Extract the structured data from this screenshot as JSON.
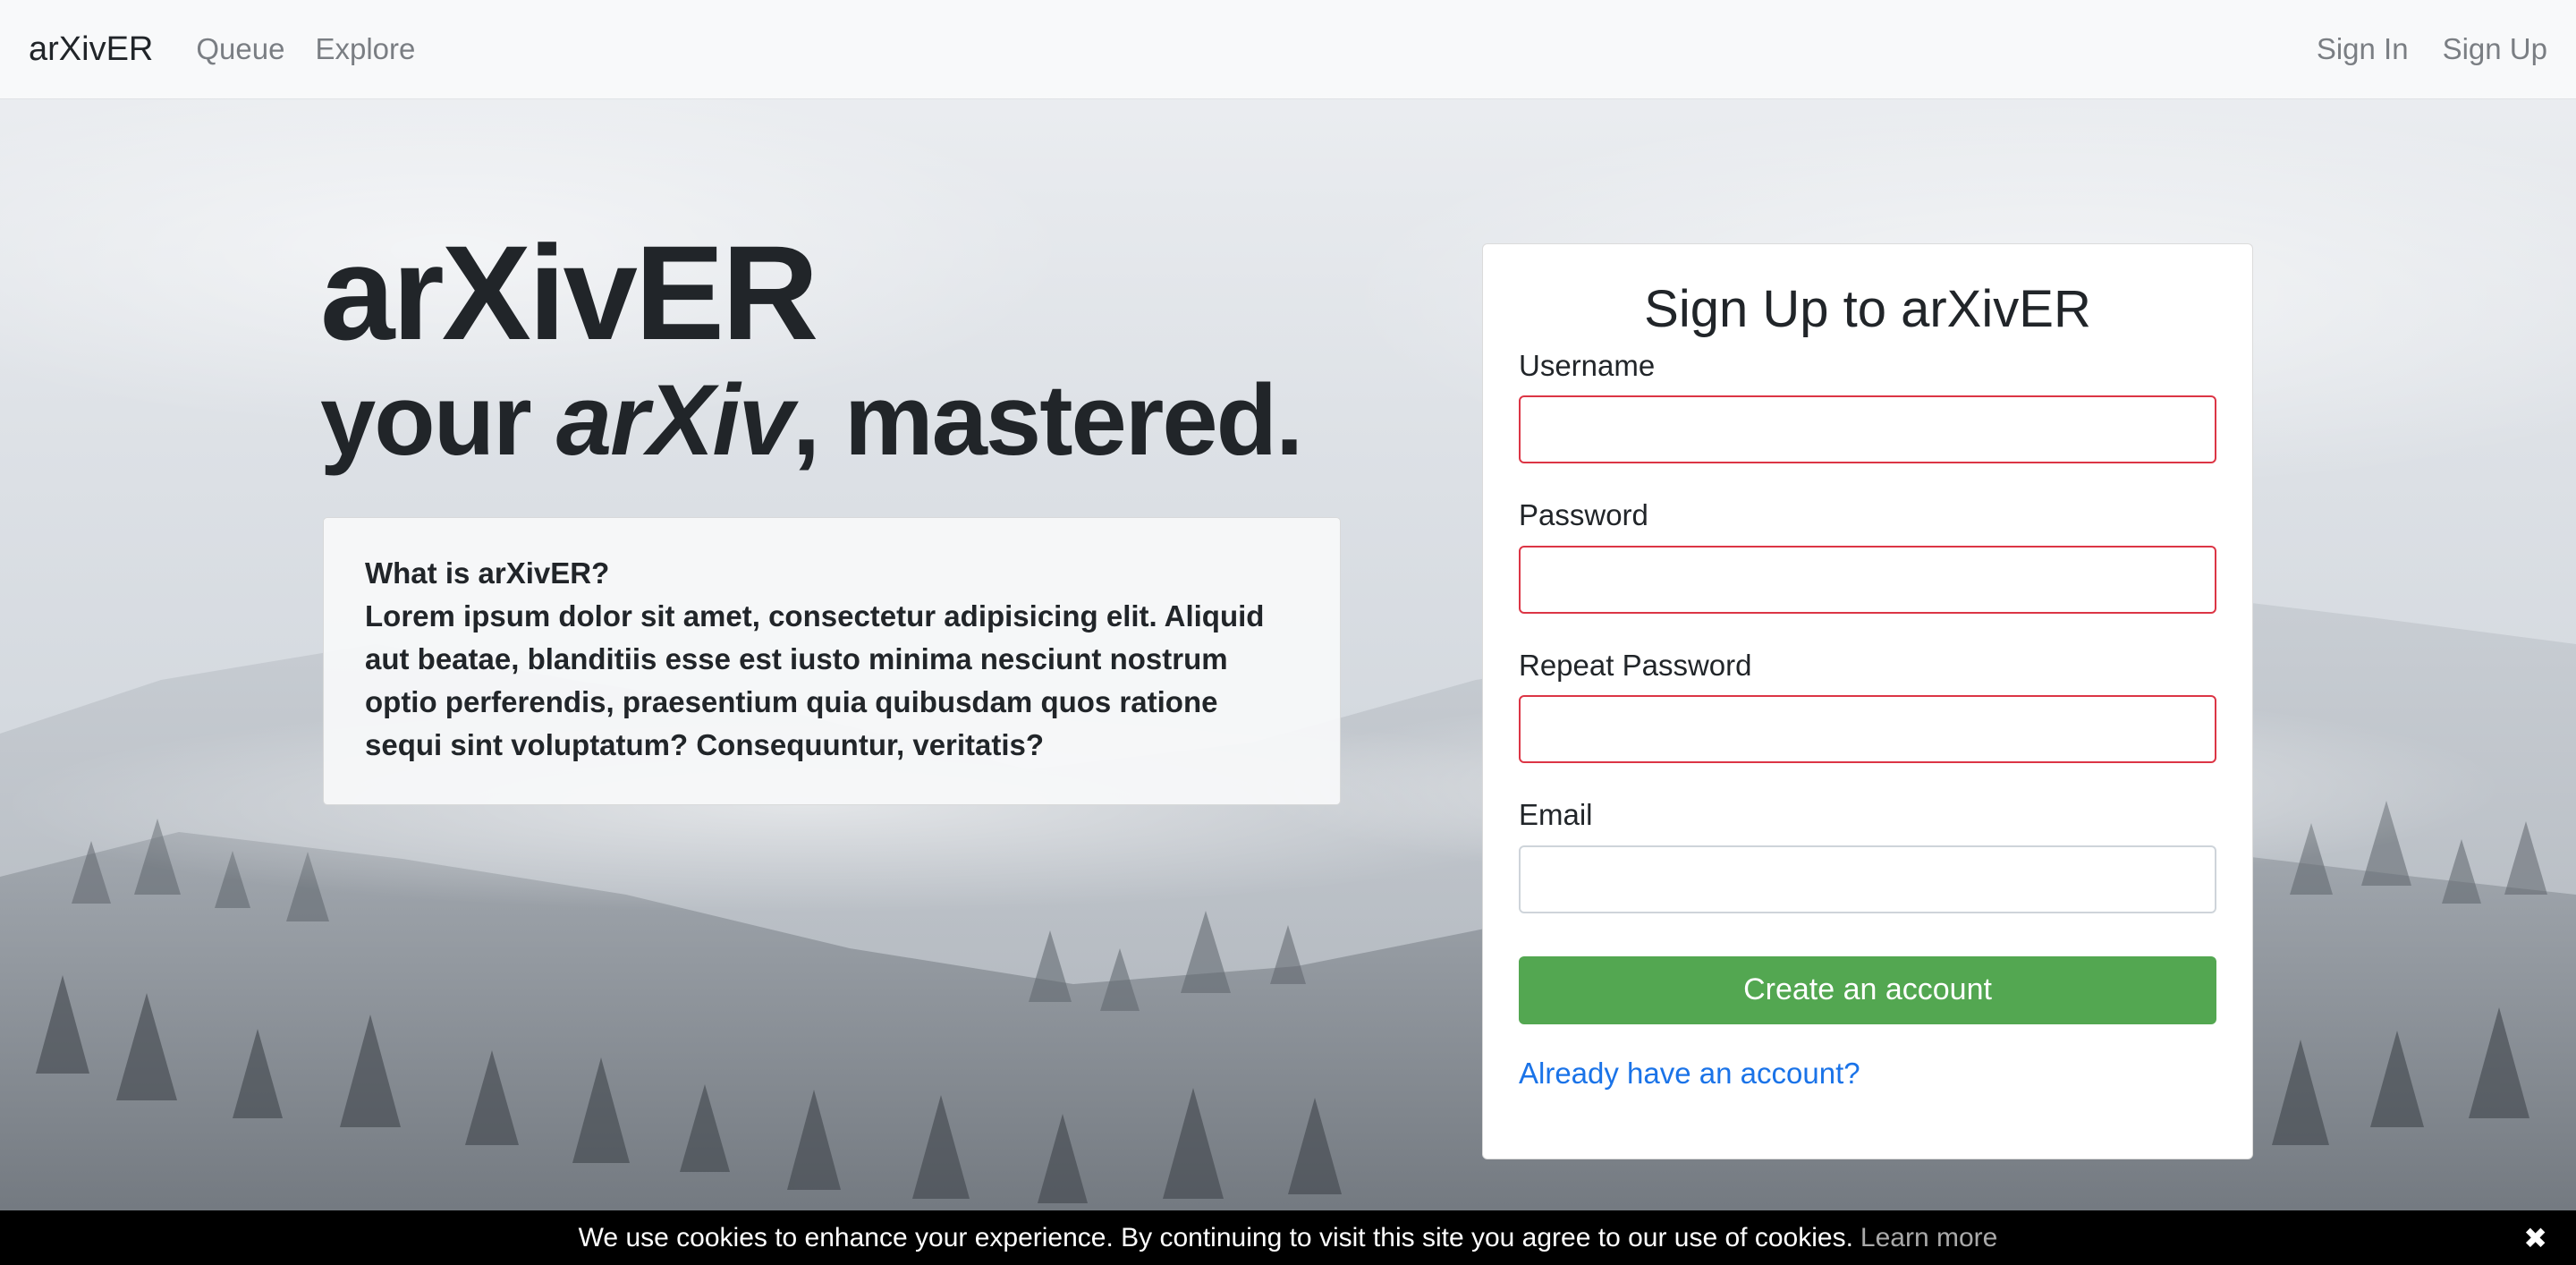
{
  "navbar": {
    "brand": "arXivER",
    "links": [
      {
        "label": "Queue"
      },
      {
        "label": "Explore"
      }
    ],
    "right_links": [
      {
        "label": "Sign In"
      },
      {
        "label": "Sign Up"
      }
    ]
  },
  "hero": {
    "title": "arXivER",
    "subtitle_prefix": "your ",
    "subtitle_emphasis": "arXiv",
    "subtitle_suffix": ", mastered.",
    "info_heading": "What is arXivER?",
    "info_body": "Lorem ipsum dolor sit amet, consectetur adipisicing elit. Aliquid aut beatae, blanditiis esse est iusto minima nesciunt nostrum optio perferendis, praesentium quia quibusdam quos ratione sequi sint voluptatum? Consequuntur, veritatis?"
  },
  "signup": {
    "title": "Sign Up to arXivER",
    "fields": [
      {
        "label": "Username",
        "value": "",
        "state": "invalid"
      },
      {
        "label": "Password",
        "value": "",
        "state": "invalid"
      },
      {
        "label": "Repeat Password",
        "value": "",
        "state": "invalid"
      },
      {
        "label": "Email",
        "value": "",
        "state": "normal"
      }
    ],
    "submit_label": "Create an account",
    "login_link": "Already have an account?"
  },
  "cookie_banner": {
    "text": "We use cookies to enhance your experience. By continuing to visit this site you agree to our use of cookies.",
    "learn_more": "Learn more",
    "close_icon": "✖"
  },
  "colors": {
    "navbar_bg": "#f8f9fa",
    "invalid_border": "#dc3545",
    "submit_bg": "#53a751",
    "link": "#1a73e8",
    "cookie_bg": "#000000"
  }
}
